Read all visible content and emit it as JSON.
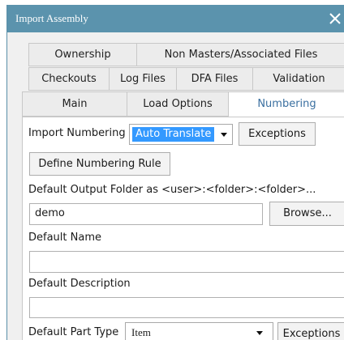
{
  "window": {
    "title": "Import Assembly"
  },
  "tabs": {
    "row1": [
      "Ownership",
      "Non Masters/Associated Files"
    ],
    "row2": [
      "Checkouts",
      "Log Files",
      "DFA Files",
      "Validation"
    ],
    "row3": [
      "Main",
      "Load Options",
      "Numbering"
    ],
    "active": "Numbering"
  },
  "numbering": {
    "import_numbering_label": "Import Numbering",
    "import_numbering_value": "Auto Translate",
    "exceptions_label": "Exceptions",
    "define_rule_label": "Define Numbering Rule",
    "output_folder_label": "Default Output Folder as <user>:<folder>:<folder>...",
    "output_folder_value": "demo",
    "browse_label": "Browse...",
    "default_name_label": "Default Name",
    "default_name_value": "",
    "default_description_label": "Default Description",
    "default_description_value": "",
    "part_type_label": "Default Part Type",
    "part_type_value": "Item",
    "part_type_exceptions_label": "Exceptions"
  },
  "colors": {
    "titlebar": "#5b93ad",
    "selection": "#3399ff",
    "active_tab_text": "#3a6fa0"
  }
}
